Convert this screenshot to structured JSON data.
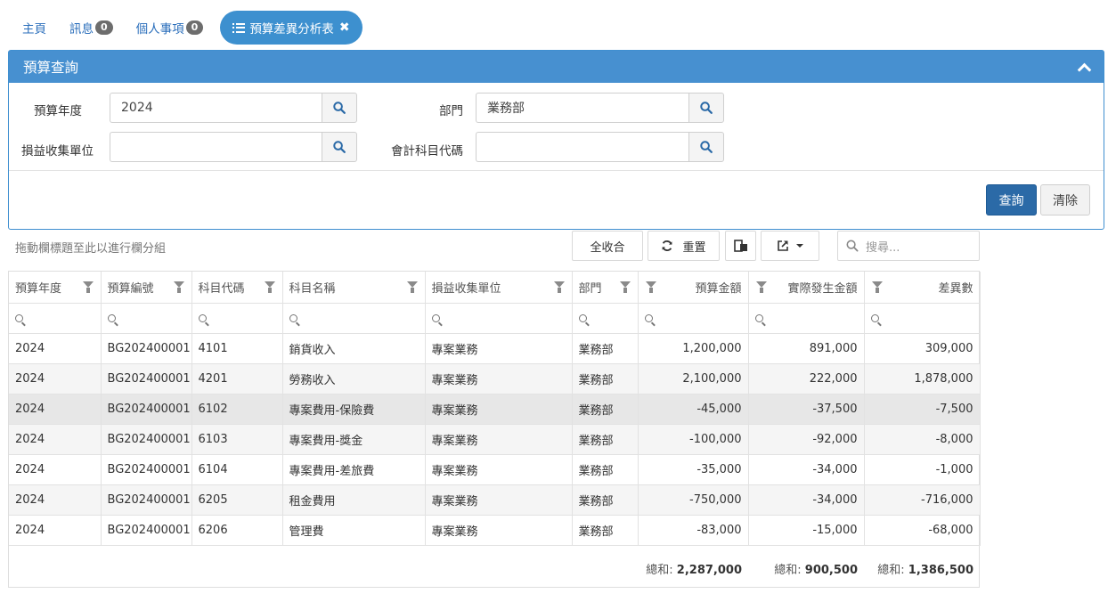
{
  "tabs": [
    {
      "label": "主頁"
    },
    {
      "label": "訊息",
      "badge": "0"
    },
    {
      "label": "個人事項",
      "badge": "0"
    },
    {
      "label": "預算差異分析表",
      "active": true
    }
  ],
  "panel": {
    "title": "預算查詢",
    "fields": {
      "year": {
        "label": "預算年度",
        "value": "2024"
      },
      "dept": {
        "label": "部門",
        "value": "業務部"
      },
      "unit": {
        "label": "損益收集單位",
        "value": ""
      },
      "account": {
        "label": "會計科目代碼",
        "value": ""
      }
    },
    "query_label": "查詢",
    "clear_label": "清除"
  },
  "toolbar": {
    "group_hint": "拖動欄標題至此以進行欄分組",
    "collapse_all": "全收合",
    "reset": "重置",
    "search_placeholder": "搜尋..."
  },
  "grid": {
    "columns": [
      "預算年度",
      "預算編號",
      "科目代碼",
      "科目名稱",
      "損益收集單位",
      "部門",
      "預算金額",
      "實際發生金額",
      "差異數"
    ],
    "rows": [
      [
        "2024",
        "BG202400001",
        "4101",
        "銷貨收入",
        "專案業務",
        "業務部",
        "1,200,000",
        "891,000",
        "309,000"
      ],
      [
        "2024",
        "BG202400001",
        "4201",
        "勞務收入",
        "專案業務",
        "業務部",
        "2,100,000",
        "222,000",
        "1,878,000"
      ],
      [
        "2024",
        "BG202400001",
        "6102",
        "專案費用-保險費",
        "專案業務",
        "業務部",
        "-45,000",
        "-37,500",
        "-7,500"
      ],
      [
        "2024",
        "BG202400001",
        "6103",
        "專案費用-獎金",
        "專案業務",
        "業務部",
        "-100,000",
        "-92,000",
        "-8,000"
      ],
      [
        "2024",
        "BG202400001",
        "6104",
        "專案費用-差旅費",
        "專案業務",
        "業務部",
        "-35,000",
        "-34,000",
        "-1,000"
      ],
      [
        "2024",
        "BG202400001",
        "6205",
        "租金費用",
        "專案業務",
        "業務部",
        "-750,000",
        "-34,000",
        "-716,000"
      ],
      [
        "2024",
        "BG202400001",
        "6206",
        "管理費",
        "專案業務",
        "業務部",
        "-83,000",
        "-15,000",
        "-68,000"
      ]
    ],
    "totals": {
      "label": "總和:",
      "budget": "2,287,000",
      "actual": "900,500",
      "diff": "1,386,500"
    }
  },
  "colors": {
    "accent": "#4790d0",
    "primary_button": "#2b6aa7",
    "badge": "#6d6d6d"
  }
}
